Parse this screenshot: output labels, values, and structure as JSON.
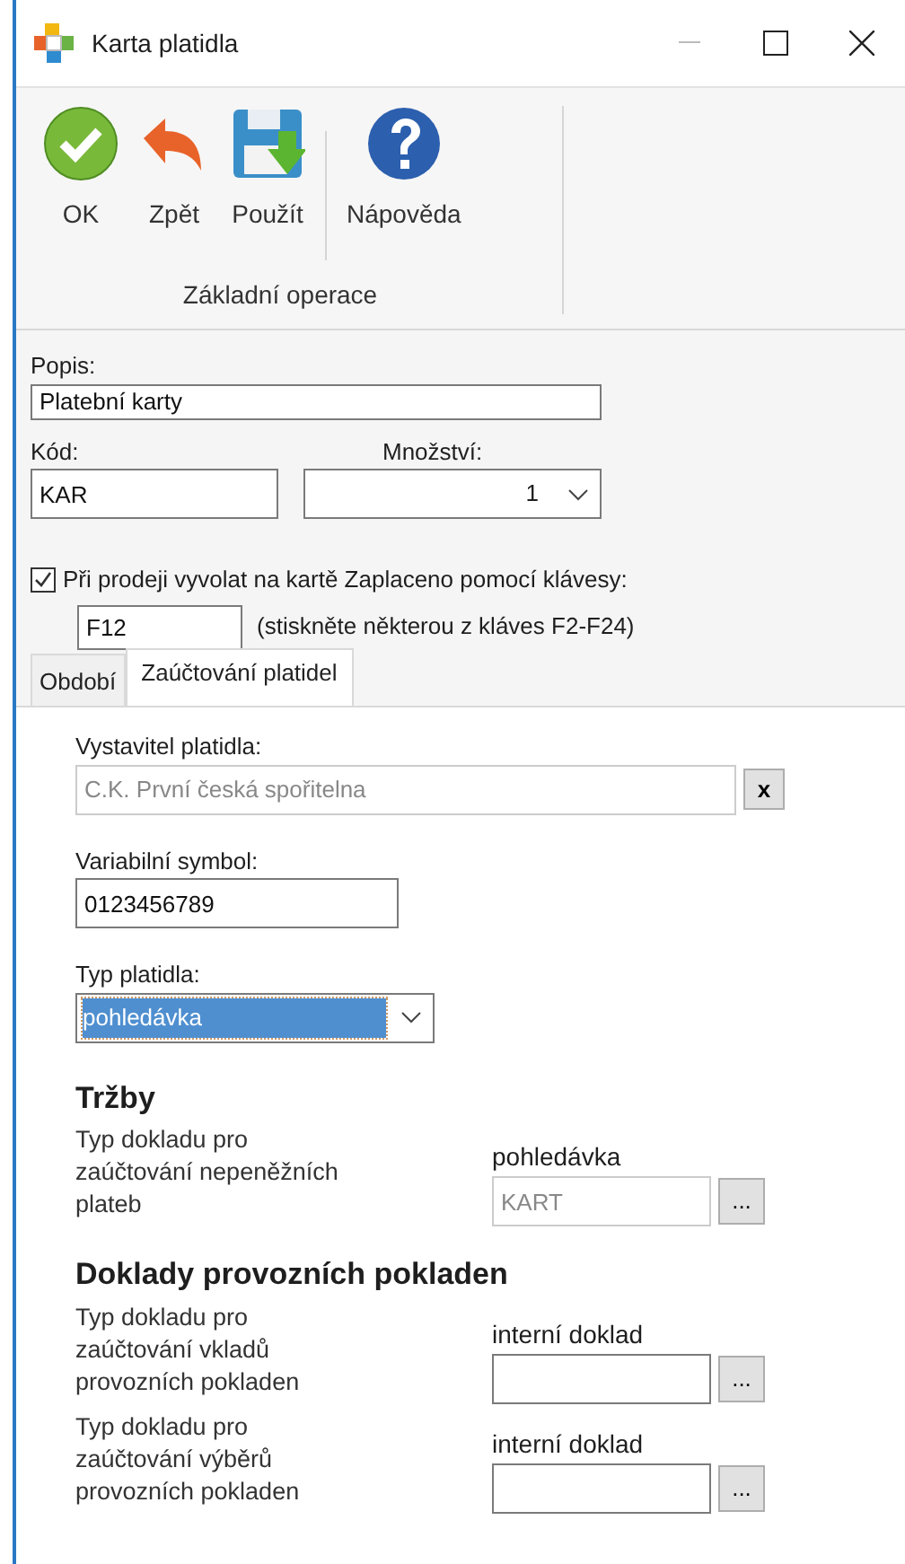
{
  "window": {
    "title": "Karta platidla"
  },
  "toolbar": {
    "groups": [
      {
        "buttons": [
          {
            "label": "OK",
            "kind": "ok"
          },
          {
            "label": "Zpět",
            "kind": "back"
          },
          {
            "label": "Použít",
            "kind": "apply"
          }
        ]
      },
      {
        "buttons": [
          {
            "label": "Nápověda",
            "kind": "help"
          }
        ]
      }
    ],
    "group_label": "Základní operace"
  },
  "form": {
    "popis": {
      "label": "Popis:",
      "value": "Platební karty"
    },
    "kod": {
      "label": "Kód:",
      "value": "KAR"
    },
    "mnozstvi": {
      "label": "Množství:",
      "value": "1"
    },
    "hotkey_checkbox": {
      "label": "Při prodeji vyvolat na kartě Zaplaceno pomocí klávesy:",
      "checked": true
    },
    "hotkey": {
      "value": "F12",
      "hint": "(stiskněte některou z kláves F2-F24)"
    }
  },
  "tabs": [
    {
      "label": "Období",
      "selected": false
    },
    {
      "label": "Zaúčtování platidel",
      "selected": true
    }
  ],
  "tab_content": {
    "issuer": {
      "label": "Vystavitel platidla:",
      "value": "C.K. První česká spořitelna",
      "disabled": true,
      "clear_button": "x"
    },
    "variable_symbol": {
      "label": "Variabilní symbol:",
      "value": "0123456789"
    },
    "payment_type": {
      "label": "Typ platidla:",
      "value": "pohledávka",
      "focused": true
    },
    "sections": [
      {
        "heading": "Tržby",
        "rows": [
          {
            "label": "Typ dokladu pro zaúčtování nepeněžních plateb",
            "caption": "pohledávka",
            "value": "KART",
            "disabled": true,
            "button": "..."
          }
        ]
      },
      {
        "heading": "Doklady provozních pokladen",
        "rows": [
          {
            "label": "Typ dokladu pro zaúčtování vkladů provozních pokladen",
            "caption": "interní doklad",
            "disabled": false,
            "button": "..."
          },
          {
            "label": "Typ dokladu pro zaúčtování výběrů provozních pokladen",
            "caption": "interní doklad",
            "disabled": false,
            "button": "..."
          }
        ]
      }
    ]
  }
}
